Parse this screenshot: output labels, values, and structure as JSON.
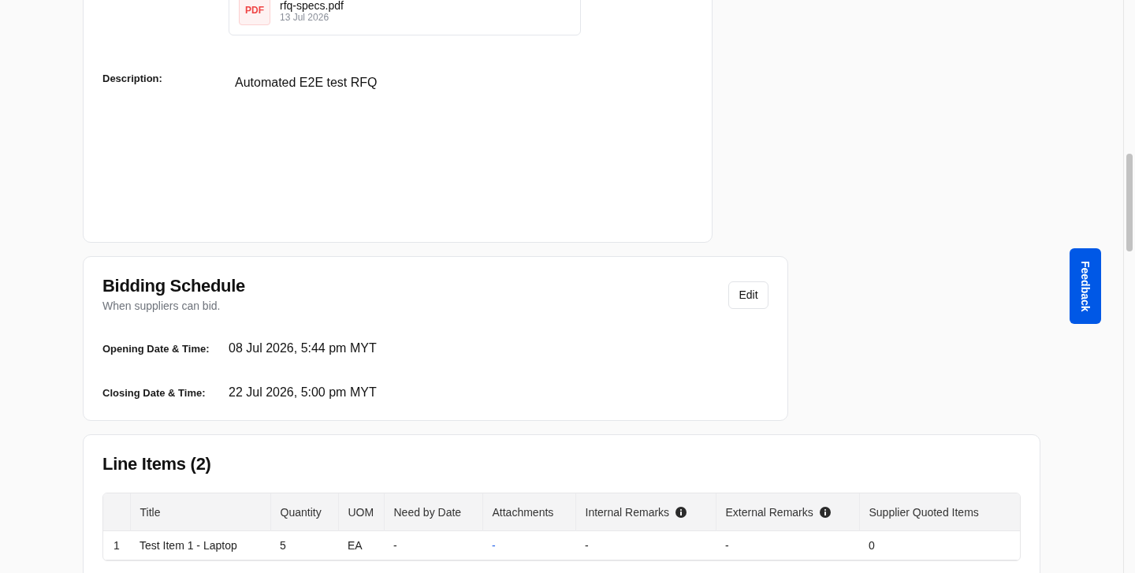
{
  "details": {
    "attachment": {
      "badge": "PDF",
      "file_name": "rfq-specs.pdf",
      "date": "13 Jul 2026"
    },
    "fields": [
      {
        "label": "Description:",
        "value": "Automated E2E test RFQ"
      }
    ]
  },
  "bidding_schedule": {
    "title": "Bidding Schedule",
    "subtitle": "When suppliers can bid.",
    "edit_button": "Edit",
    "fields": [
      {
        "label": "Opening Date & Time:",
        "value": "08 Jul 2026, 5:44 pm MYT"
      },
      {
        "label": "Closing Date & Time:",
        "value": "22 Jul 2026, 5:00 pm MYT"
      }
    ]
  },
  "line_items": {
    "title": "Line Items (2)",
    "columns": [
      {
        "label": "Title",
        "kind": "text",
        "info": false
      },
      {
        "label": "Quantity",
        "kind": "text",
        "info": false
      },
      {
        "label": "UOM",
        "kind": "text",
        "info": false
      },
      {
        "label": "Need by Date",
        "kind": "text",
        "info": false
      },
      {
        "label": "Attachments",
        "kind": "link",
        "info": false
      },
      {
        "label": "Internal Remarks",
        "kind": "text",
        "info": true
      },
      {
        "label": "External Remarks",
        "kind": "text",
        "info": true
      },
      {
        "label": "Supplier Quoted Items",
        "kind": "text",
        "info": false
      }
    ],
    "rows": [
      {
        "number": "1",
        "cells": [
          "Test Item 1 - Laptop",
          "5",
          "EA",
          "-",
          "-",
          "-",
          "-",
          "0"
        ]
      }
    ]
  },
  "feedback_button": {
    "label": "Feedback"
  }
}
